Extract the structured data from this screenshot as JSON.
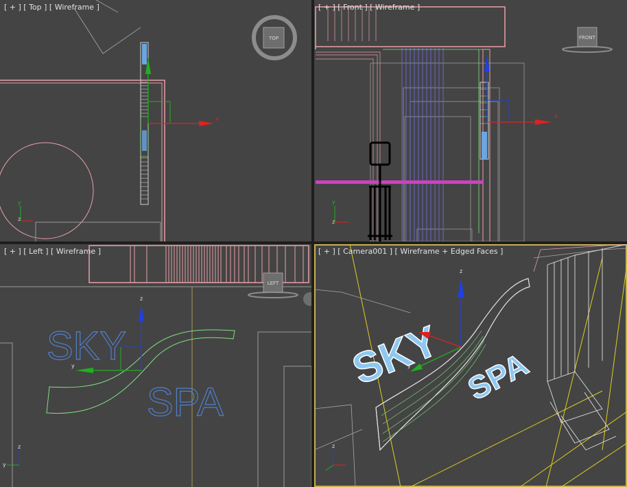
{
  "viewports": {
    "top": {
      "label": "[ + ] [ Top ] [ Wireframe ]",
      "cube_label": "TOP"
    },
    "front": {
      "label": "[ + ] [ Front ] [ Wireframe ]",
      "cube_label": "FRONT"
    },
    "left": {
      "label": "[ + ] [ Left ] [ Wireframe ]",
      "cube_label": "LEFT"
    },
    "camera": {
      "label": "[ + ] [ Camera001 ] [ Wireframe + Edged Faces ]"
    }
  },
  "gizmo_axes": {
    "x": "x",
    "y": "y",
    "z": "z"
  },
  "sign": {
    "word1": "SKY",
    "word2": "SPA"
  },
  "colors": {
    "viewport_bg": "#444444",
    "wire_pink": "#e8a0a8",
    "wire_light": "#c8c8c8",
    "wire_blue": "#6a6ad8",
    "wire_green": "#80e080",
    "magenta": "#d040c0",
    "axis_x": "#e02020",
    "axis_y": "#20b020",
    "axis_z": "#2040e0",
    "active_border": "#c8b050",
    "sign_blue": "#5080d0"
  }
}
